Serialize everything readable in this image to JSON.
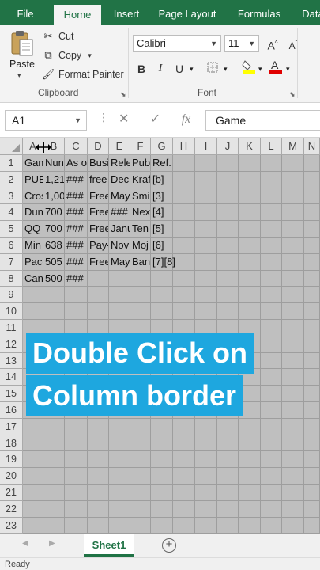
{
  "tabs": [
    "File",
    "Home",
    "Insert",
    "Page Layout",
    "Formulas",
    "Data"
  ],
  "ribbon": {
    "clipboard": {
      "paste": "Paste",
      "cut": "Cut",
      "copy": "Copy",
      "format_painter": "Format Painter",
      "label": "Clipboard"
    },
    "font": {
      "name": "Calibri",
      "size": "11",
      "grow": "A",
      "shrink": "A",
      "bold": "B",
      "italic": "I",
      "underline": "U",
      "label": "Font",
      "highlight_color": "#ffff00",
      "font_color": "#e00000"
    }
  },
  "formula_bar": {
    "name_box": "A1",
    "fx": "fx",
    "value": "Game"
  },
  "grid": {
    "columns": [
      "A",
      "B",
      "C",
      "D",
      "E",
      "F",
      "G",
      "H",
      "I",
      "J",
      "K",
      "L",
      "M",
      "N"
    ],
    "rows": [
      "1",
      "2",
      "3",
      "4",
      "5",
      "6",
      "7",
      "8",
      "9",
      "10",
      "11",
      "12",
      "13",
      "14",
      "15",
      "16",
      "17",
      "18",
      "19",
      "20",
      "21",
      "22",
      "23"
    ],
    "cells": [
      [
        "Gam",
        "Nun",
        "As o",
        "Busi",
        "Rele",
        "Pub",
        "Ref."
      ],
      [
        "PUB",
        "1,21",
        "###",
        "free",
        "Dec",
        "Kraf",
        "[b]"
      ],
      [
        "Cros",
        "1,00",
        "###",
        "Free",
        "May",
        "Smi",
        "[3]"
      ],
      [
        "Dun",
        "700",
        "###",
        "Free",
        "###",
        "Nex",
        "[4]"
      ],
      [
        "QQ",
        "700",
        "###",
        "Free",
        "Janu",
        "Ten",
        "[5]"
      ],
      [
        "Min",
        "638",
        "###",
        "Pay-",
        "Nov",
        "Moj",
        "[6]"
      ],
      [
        "Pac-",
        "505",
        "###",
        "Free",
        "May",
        "Ban",
        "[7][8]"
      ],
      [
        "Can",
        "500",
        "###",
        "",
        "",
        "",
        ""
      ]
    ]
  },
  "caption": {
    "line1": "Double Click on",
    "line2": "Column border"
  },
  "sheets": {
    "active": "Sheet1",
    "add": "+"
  },
  "status": "Ready"
}
